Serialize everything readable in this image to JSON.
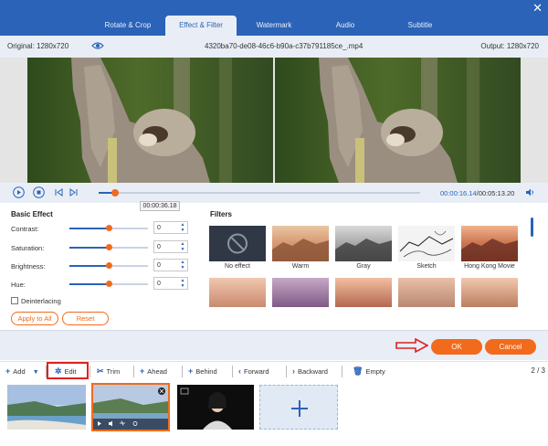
{
  "tabs": [
    {
      "label": "Rotate & Crop"
    },
    {
      "label": "Effect & Filter"
    },
    {
      "label": "Watermark"
    },
    {
      "label": "Audio"
    },
    {
      "label": "Subtitle"
    }
  ],
  "infobar": {
    "original": "Original: 1280x720",
    "filename": "4320ba70-de08-46c6-b90a-c37b791185ce_.mp4",
    "output": "Output: 1280x720"
  },
  "playback": {
    "current_time": "00:00:16.14",
    "total_time": "/00:05:13.20",
    "tooltip_time": "00:00:36.18",
    "progress_fraction": 0.05
  },
  "basic_effect": {
    "title": "Basic Effect",
    "rows": [
      {
        "label": "Contrast:",
        "value": "0",
        "level": 0.5
      },
      {
        "label": "Saturation:",
        "value": "0",
        "level": 0.5
      },
      {
        "label": "Brightness:",
        "value": "0",
        "level": 0.5
      },
      {
        "label": "Hue:",
        "value": "0",
        "level": 0.5
      }
    ],
    "deinterlacing": "Deinterlacing",
    "apply_all": "Apply to All",
    "reset": "Reset"
  },
  "filters": {
    "title": "Filters",
    "items": [
      {
        "name": "No effect"
      },
      {
        "name": "Warm"
      },
      {
        "name": "Gray"
      },
      {
        "name": "Sketch"
      },
      {
        "name": "Hong Kong Movie"
      }
    ]
  },
  "footer": {
    "ok": "OK",
    "cancel": "Cancel"
  },
  "toolbar": {
    "add": "Add",
    "edit": "Edit",
    "trim": "Trim",
    "ahead": "Ahead",
    "behind": "Behind",
    "forward": "Forward",
    "backward": "Backward",
    "empty": "Empty",
    "counter": "2 / 3"
  },
  "colors": {
    "accent": "#2a63b7",
    "orange": "#f26a1b",
    "highlight": "#e02020"
  }
}
